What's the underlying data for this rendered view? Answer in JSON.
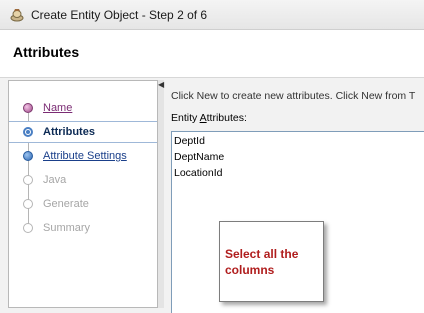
{
  "window": {
    "title": "Create Entity Object - Step 2 of 6",
    "icon": "entity-object-app-icon"
  },
  "header": {
    "title": "Attributes"
  },
  "nav": {
    "items": [
      {
        "label": "Name",
        "state": "visited"
      },
      {
        "label": "Attributes",
        "state": "current"
      },
      {
        "label": "Attribute Settings",
        "state": "link"
      },
      {
        "label": "Java",
        "state": "disabled"
      },
      {
        "label": "Generate",
        "state": "disabled"
      },
      {
        "label": "Summary",
        "state": "disabled"
      }
    ]
  },
  "main": {
    "instructions": "Click New to create new attributes.  Click New from T",
    "entity_attributes_label_mnemonic": "A",
    "entity_attributes_label_rest": "ttributes:",
    "entity_attributes_label_prefix": "Entity ",
    "attributes": [
      "DeptId",
      "DeptName",
      "LocationId"
    ]
  },
  "callout": {
    "text": "Select all the columns"
  },
  "colors": {
    "selected_border": "#9fb8d8",
    "callout_text": "#b01d1d",
    "link": "#1a3f8a",
    "visited": "#7b2c74"
  }
}
